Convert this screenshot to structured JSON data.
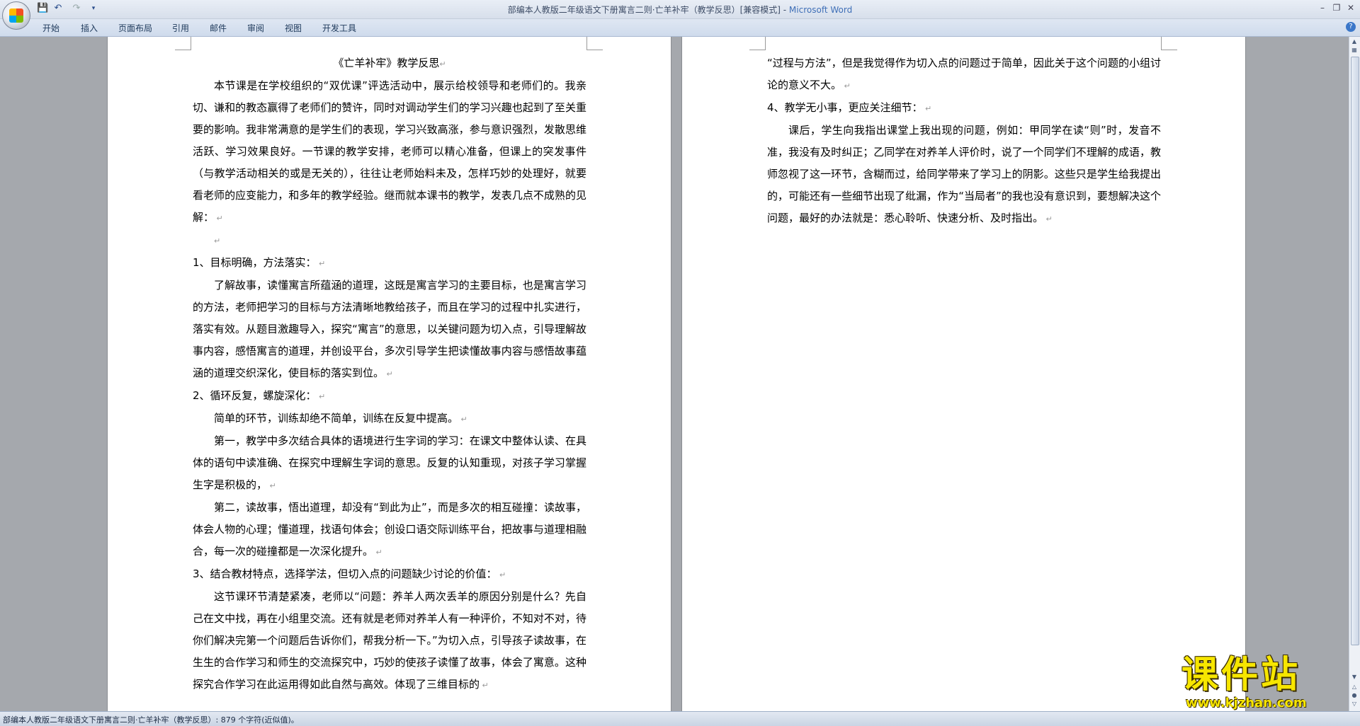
{
  "window": {
    "title_doc": "部编本人教版二年级语文下册寓言二则·亡羊补牢（教学反思）[兼容模式] - ",
    "title_app": "Microsoft Word"
  },
  "ribbon": {
    "tabs": [
      "开始",
      "插入",
      "页面布局",
      "引用",
      "邮件",
      "审阅",
      "视图",
      "开发工具"
    ]
  },
  "page1": {
    "title": "《亡羊补牢》教学反思",
    "paragraphs": [
      {
        "text": "本节课是在学校组织的“双优课”评选活动中，展示给校领导和老师们的。我亲切、谦和的教态赢得了老师们的赞许，同时对调动学生们的学习兴趣也起到了至关重要的影响。我非常满意的是学生们的表现，学习兴致高涨，参与意识强烈，发散思维活跃、学习效果良好。一节课的教学安排，老师可以精心准备，但课上的突发事件（与教学活动相关的或是无关的），往往让老师始料未及，怎样巧妙的处理好，就要看老师的应变能力，和多年的教学经验。继而就本课书的教学，发表几点不成熟的见解：",
        "indent": true
      },
      {
        "text": "",
        "indent": true
      },
      {
        "text": "1、目标明确，方法落实：",
        "indent": false
      },
      {
        "text": "了解故事，读懂寓言所蕴涵的道理，这既是寓言学习的主要目标，也是寓言学习的方法，老师把学习的目标与方法清晰地教给孩子，而且在学习的过程中扎实进行，落实有效。从题目激趣导入，探究“寓言”的意思，以关键问题为切入点，引导理解故事内容，感悟寓言的道理，并创设平台，多次引导学生把读懂故事内容与感悟故事蕴涵的道理交织深化，使目标的落实到位。",
        "indent": true
      },
      {
        "text": "2、循环反复，螺旋深化：",
        "indent": false
      },
      {
        "text": "简单的环节，训练却绝不简单，训练在反复中提高。",
        "indent": true
      },
      {
        "text": "第一，教学中多次结合具体的语境进行生字词的学习：在课文中整体认读、在具体的语句中读准确、在探究中理解生字词的意思。反复的认知重现，对孩子学习掌握生字是积极的，",
        "indent": true
      },
      {
        "text": "第二，读故事，悟出道理，却没有“到此为止”，而是多次的相互碰撞：读故事，体会人物的心理；懂道理，找语句体会；创设口语交际训练平台，把故事与道理相融合，每一次的碰撞都是一次深化提升。",
        "indent": true
      },
      {
        "text": "3、结合教材特点，选择学法，但切入点的问题缺少讨论的价值：",
        "indent": false
      },
      {
        "text": "这节课环节清楚紧凑，老师以“问题：养羊人两次丢羊的原因分别是什么？先自己在文中找，再在小组里交流。还有就是老师对养羊人有一种评价，不知对不对，待你们解决完第一个问题后告诉你们，帮我分析一下。”为切入点，引导孩子读故事，在生生的合作学习和师生的交流探究中，巧妙的使孩子读懂了故事，体会了寓意。这种探究合作学习在此运用得如此自然与高效。体现了三维目标的",
        "indent": true
      }
    ]
  },
  "page2": {
    "paragraphs": [
      {
        "text": "“过程与方法”，但是我觉得作为切入点的问题过于简单，因此关于这个问题的小组讨论的意义不大。",
        "indent": false
      },
      {
        "text": "4、教学无小事，更应关注细节：",
        "indent": false
      },
      {
        "text": "课后，学生向我指出课堂上我出现的问题，例如：甲同学在读“则”时，发音不准，我没有及时纠正；乙同学在对养羊人评价时，说了一个同学们不理解的成语，教师忽视了这一环节，含糊而过，给同学带来了学习上的阴影。这些只是学生给我提出的，可能还有一些细节出现了纰漏，作为“当局者”的我也没有意识到，要想解决这个问题，最好的办法就是：悉心聆听、快速分析、及时指出。",
        "indent": true
      }
    ]
  },
  "status": {
    "text": "部编本人教版二年级语文下册寓言二则·亡羊补牢（教学反思）: 879 个字符(近似值)。"
  },
  "watermark": {
    "main": "课件站",
    "url": "www.kjzhan.com"
  }
}
